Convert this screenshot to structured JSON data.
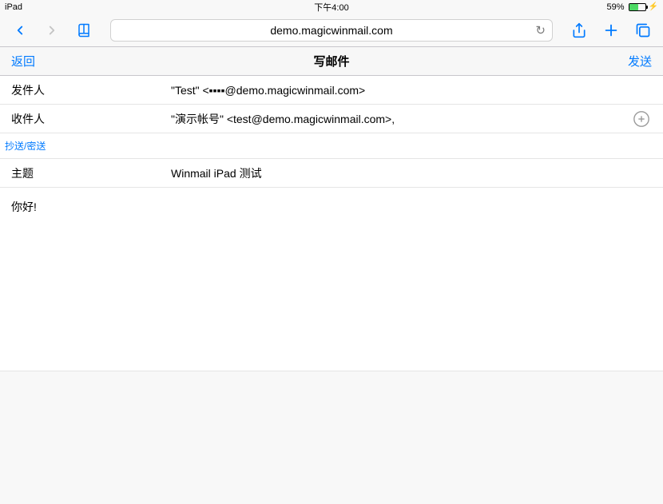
{
  "status_bar": {
    "device": "iPad",
    "time": "下午4:00",
    "battery_percent": "59%"
  },
  "browser": {
    "url": "demo.magicwinmail.com"
  },
  "page_header": {
    "back": "返回",
    "title": "写邮件",
    "send": "发送"
  },
  "form": {
    "sender_label": "发件人",
    "sender_value": "\"Test\" <▪▪▪▪@demo.magicwinmail.com>",
    "recipient_label": "收件人",
    "recipient_value": "\"演示帐号\" <test@demo.magicwinmail.com>,",
    "cc_bcc": "抄送/密送",
    "subject_label": "主题",
    "subject_value": "Winmail iPad 测试"
  },
  "body": {
    "content": "你好!"
  }
}
